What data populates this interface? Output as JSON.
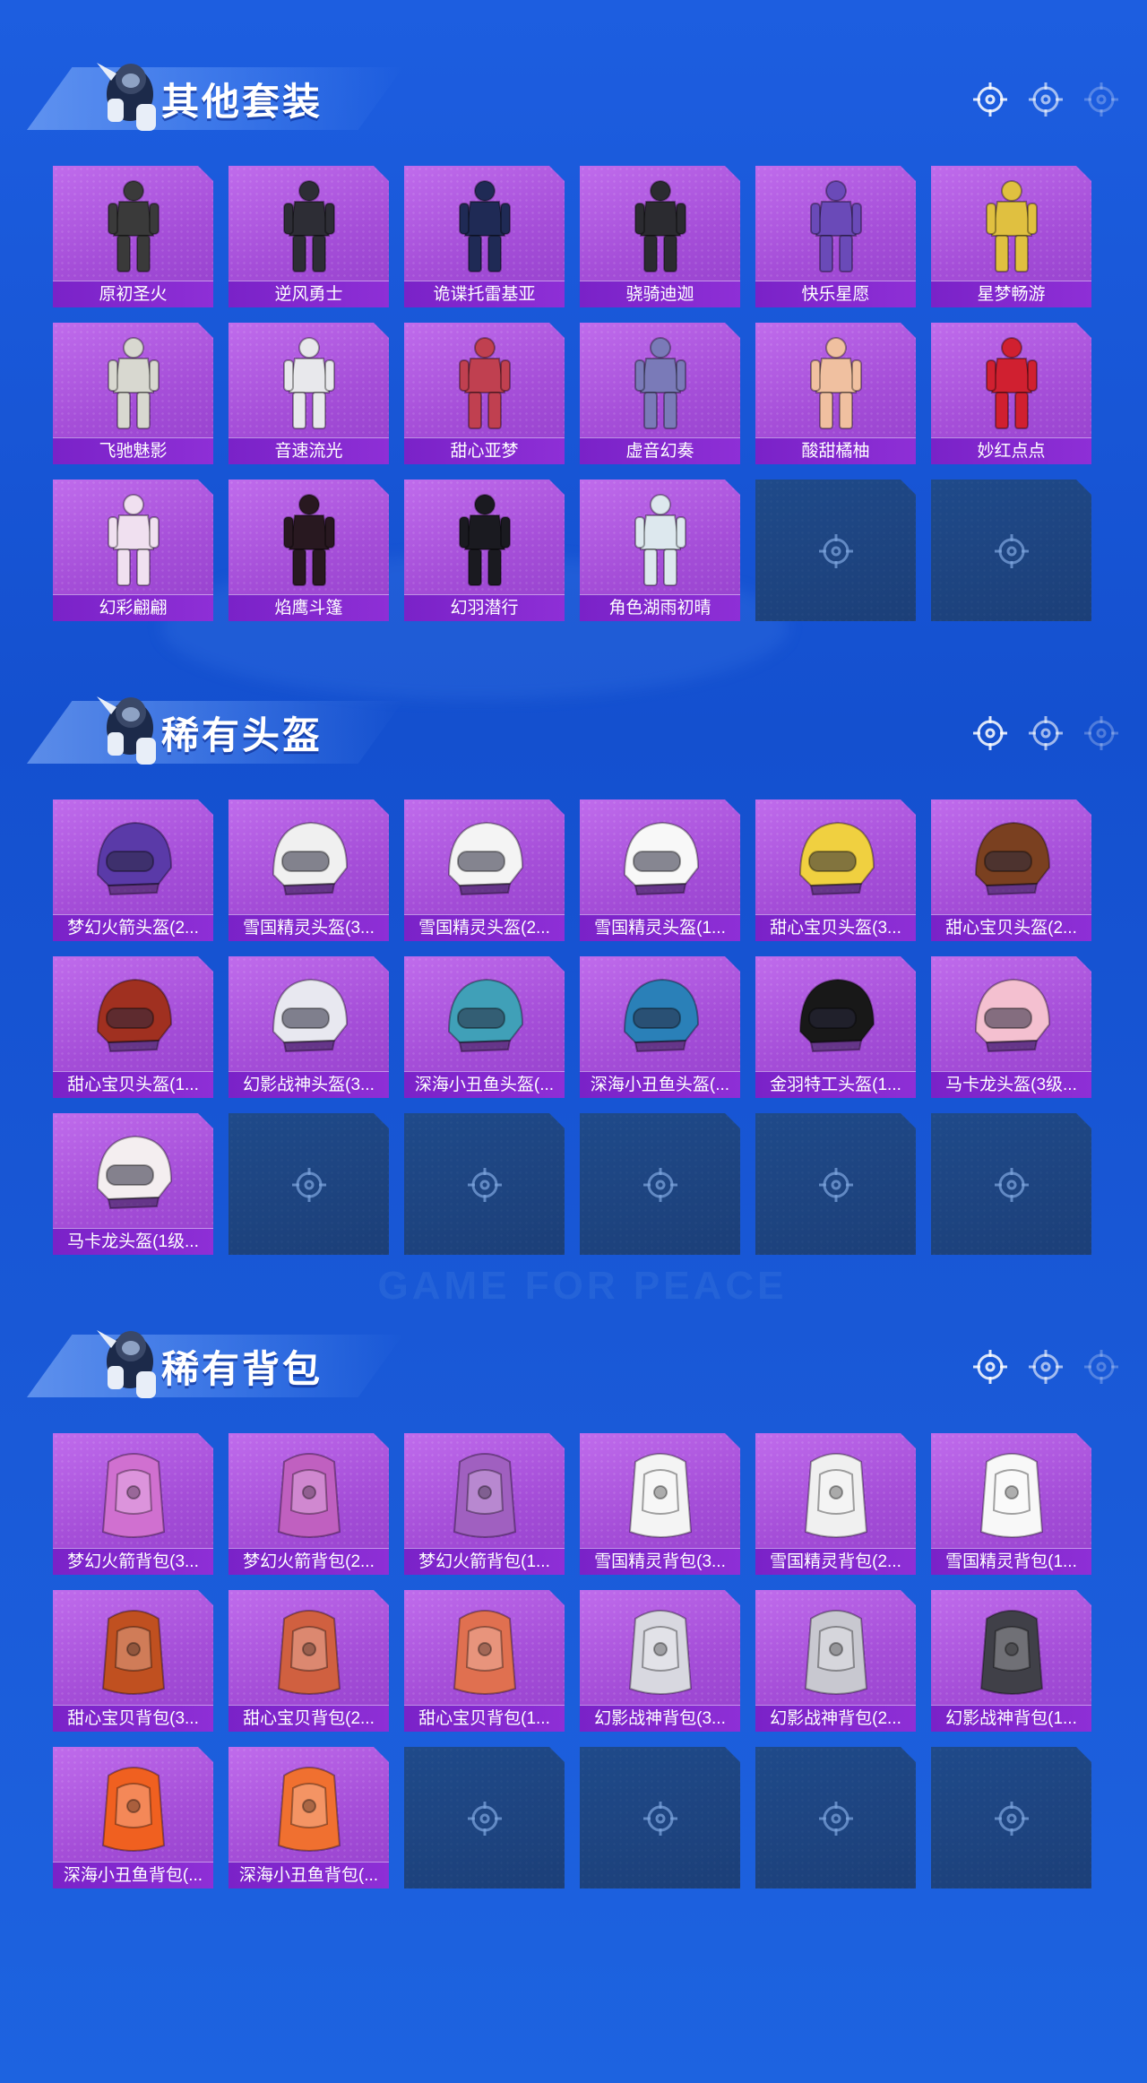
{
  "sections": [
    {
      "title": "其他套装",
      "items": [
        "原初圣火",
        "逆风勇士",
        "诡谍托雷基亚",
        "骁骑迪迦",
        "快乐星愿",
        "星梦畅游",
        "飞驰魅影",
        "音速流光",
        "甜心亚梦",
        "虚音幻奏",
        "酸甜橘柚",
        "妙红点点",
        "幻彩翩翩",
        "焰鹰斗篷",
        "幻羽潜行",
        "角色湖雨初晴"
      ],
      "empty_slots": 2,
      "art_colors": [
        "#3a3a3a",
        "#2d2d35",
        "#1f2a55",
        "#2b2b30",
        "#6a4ab8",
        "#e0c040",
        "#d8d8d0",
        "#e8e8ec",
        "#c04050",
        "#7a7ab8",
        "#f0c0a0",
        "#d02030",
        "#f0e0f0",
        "#281820",
        "#1a1a20",
        "#dde8ee"
      ]
    },
    {
      "title": "稀有头盔",
      "items": [
        "梦幻火箭头盔(2...",
        "雪国精灵头盔(3...",
        "雪国精灵头盔(2...",
        "雪国精灵头盔(1...",
        "甜心宝贝头盔(3...",
        "甜心宝贝头盔(2...",
        "甜心宝贝头盔(1...",
        "幻影战神头盔(3...",
        "深海小丑鱼头盔(...",
        "深海小丑鱼头盔(...",
        "金羽特工头盔(1...",
        "马卡龙头盔(3级...",
        "马卡龙头盔(1级..."
      ],
      "empty_slots": 5,
      "art_colors": [
        "#5a3aa8",
        "#f0f0f0",
        "#f4f4f4",
        "#f8f8f8",
        "#f0d040",
        "#7a4020",
        "#a03020",
        "#e8e8f0",
        "#40a0b8",
        "#2a80b8",
        "#181818",
        "#f4c0d0",
        "#f4eef0"
      ]
    },
    {
      "title": "稀有背包",
      "items": [
        "梦幻火箭背包(3...",
        "梦幻火箭背包(2...",
        "梦幻火箭背包(1...",
        "雪国精灵背包(3...",
        "雪国精灵背包(2...",
        "雪国精灵背包(1...",
        "甜心宝贝背包(3...",
        "甜心宝贝背包(2...",
        "甜心宝贝背包(1...",
        "幻影战神背包(3...",
        "幻影战神背包(2...",
        "幻影战神背包(1...",
        "深海小丑鱼背包(...",
        "深海小丑鱼背包(..."
      ],
      "empty_slots": 4,
      "art_colors": [
        "#d070d0",
        "#c060c0",
        "#a060c0",
        "#f4f4f4",
        "#f0f0f0",
        "#f8f8f8",
        "#c05020",
        "#d06040",
        "#e07050",
        "#d8d8e0",
        "#c8c8d0",
        "#404048",
        "#f06020",
        "#f07030"
      ]
    }
  ],
  "watermark": "GAME FOR PEACE"
}
